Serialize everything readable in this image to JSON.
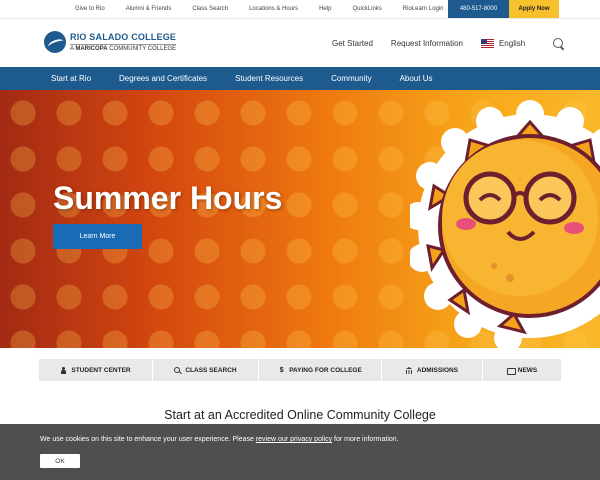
{
  "utility": {
    "links": [
      "Give to Rio",
      "Alumni & Friends",
      "Class Search",
      "Locations & Hours",
      "Help",
      "QuickLinks",
      "RioLearn Login"
    ],
    "phone": "480-517-8000",
    "apply": "Apply Now"
  },
  "header": {
    "logo_name": "RIO SALADO COLLEGE",
    "logo_sub_prefix": "A ",
    "logo_sub_bold": "MARICOPA",
    "logo_sub_suffix": " COMMUNITY COLLEGE",
    "get_started": "Get Started",
    "request_info": "Request Information",
    "language": "English"
  },
  "mainnav": [
    "Start at Rio",
    "Degrees and Certificates",
    "Student Resources",
    "Community",
    "About Us"
  ],
  "hero": {
    "title": "Summer Hours",
    "button": "Learn More"
  },
  "quick_links": [
    {
      "label": "STUDENT CENTER",
      "icon": "person-icon"
    },
    {
      "label": "CLASS SEARCH",
      "icon": "search-icon"
    },
    {
      "label": "PAYING FOR COLLEGE",
      "icon": "dollar-icon"
    },
    {
      "label": "ADMISSIONS",
      "icon": "bank-icon"
    },
    {
      "label": "NEWS",
      "icon": "news-icon"
    }
  ],
  "section": {
    "title": "Start at an Accredited Online Community College"
  },
  "cookie": {
    "text_before": "We use cookies on this site to enhance your user experience. Please ",
    "link": "review our privacy policy",
    "text_after": " for more information.",
    "ok": "OK"
  },
  "colors": {
    "brand_blue": "#1d5a8e",
    "apply_yellow": "#f7c12d",
    "button_blue": "#1a6bb5"
  }
}
